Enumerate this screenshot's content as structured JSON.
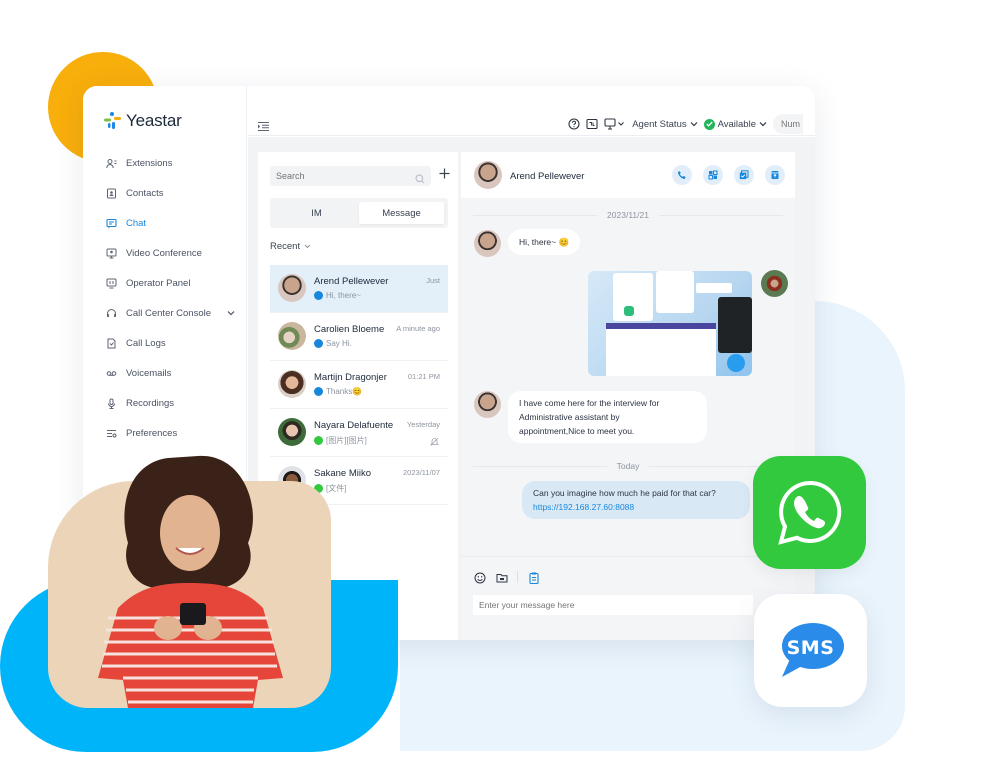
{
  "colors": {
    "accent": "#1787dd",
    "yellow_deco": "#f8ae0b",
    "blue_deco": "#00b4fa",
    "beige_deco": "#ecd4b8",
    "light_blue_deco": "#eaf4fc",
    "whatsapp_green": "#32c93f",
    "sms_blue": "#2b8be8",
    "available_green": "#22b55a"
  },
  "app": {
    "brand": "Yeastar"
  },
  "sidebar": {
    "items": [
      {
        "label": "Extensions",
        "icon": "users-icon"
      },
      {
        "label": "Contacts",
        "icon": "contacts-icon"
      },
      {
        "label": "Chat",
        "icon": "chat-icon",
        "active": true
      },
      {
        "label": "Video Conference",
        "icon": "video-conference-icon"
      },
      {
        "label": "Operator Panel",
        "icon": "operator-panel-icon"
      },
      {
        "label": "Call Center Console",
        "icon": "headset-icon",
        "expandable": true
      },
      {
        "label": "Call Logs",
        "icon": "call-logs-icon"
      },
      {
        "label": "Voicemails",
        "icon": "voicemail-icon"
      },
      {
        "label": "Recordings",
        "icon": "microphone-icon"
      },
      {
        "label": "Preferences",
        "icon": "preferences-icon"
      }
    ]
  },
  "topbar": {
    "agent_status_label": "Agent Status",
    "availability": "Available",
    "number_placeholder": "Num"
  },
  "conversations": {
    "search_placeholder": "Search",
    "tabs": [
      "IM",
      "Message"
    ],
    "active_tab": "Message",
    "filter_label": "Recent",
    "items": [
      {
        "name": "Arend Pellewever",
        "time": "Just",
        "preview": "Hi, there~",
        "channel": "im",
        "active": true
      },
      {
        "name": "Carolien Bloeme",
        "time": "A minute ago",
        "preview": "Say Hi.",
        "channel": "im"
      },
      {
        "name": "Martijn Dragonjer",
        "time": "01:21 PM",
        "preview": "Thanks😊",
        "channel": "im"
      },
      {
        "name": "Nayara Delafuente",
        "time": "Yesterday",
        "preview": "[图片][图片]",
        "channel": "whatsapp",
        "muted": true
      },
      {
        "name": "Sakane Miiko",
        "time": "2023/11/07",
        "preview": "[文件]",
        "channel": "whatsapp"
      }
    ]
  },
  "chat": {
    "contact_name": "Arend Pellewever",
    "date_divider_1": "2023/11/21",
    "msg_1": "Hi, there~ 😊",
    "msg_2_lines": [
      "I have come here for the interview for",
      "Administrative assistant by",
      "appointment,Nice to meet you."
    ],
    "date_divider_2": "Today",
    "msg_3_text": "Can you imagine how much he paid for that car?",
    "msg_3_link": "https://192.168.27.60:8088",
    "input_placeholder": "Enter your message here"
  },
  "badges": {
    "sms_label": "SMS"
  }
}
